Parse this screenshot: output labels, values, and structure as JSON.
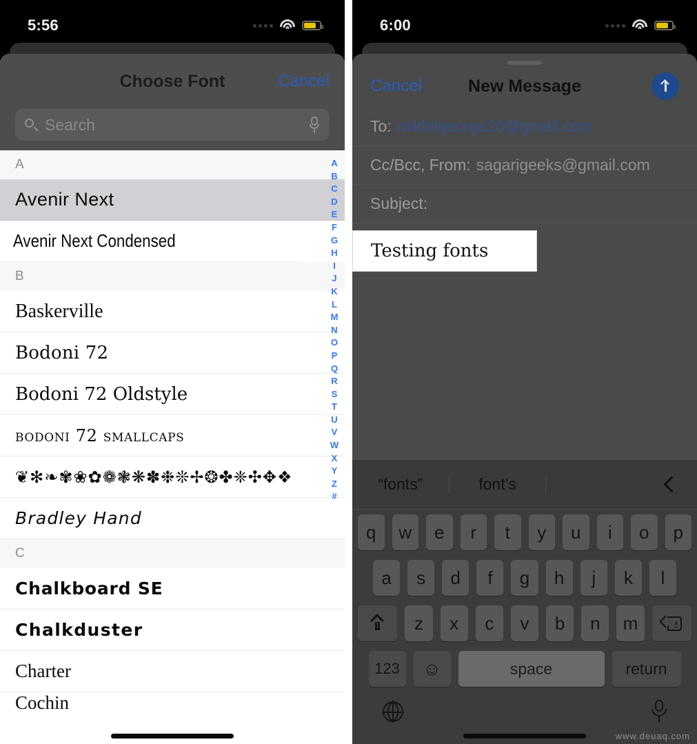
{
  "left_screen": {
    "status_bar": {
      "time": "5:56",
      "wifi_icon": "wifi-icon",
      "battery_icon": "battery-icon",
      "signal_icon": "signal-dots-icon"
    },
    "nav": {
      "title": "Choose Font",
      "cancel_label": "Cancel"
    },
    "search": {
      "placeholder": "Search",
      "value": "",
      "search_icon": "search-icon",
      "dictation_icon": "microphone-icon"
    },
    "sections": [
      {
        "letter": "A",
        "fonts": [
          {
            "name": "Avenir Next",
            "style": "f-avenir",
            "selected": true
          },
          {
            "name": "Avenir Next Condensed",
            "style": "f-avenir-cond",
            "selected": false
          }
        ]
      },
      {
        "letter": "B",
        "fonts": [
          {
            "name": "Baskerville",
            "style": "f-serif",
            "selected": false
          },
          {
            "name": "Bodoni 72",
            "style": "f-bodoni",
            "selected": false
          },
          {
            "name": "Bodoni 72 Oldstyle",
            "style": "f-oldstyle",
            "selected": false
          },
          {
            "name": "Bodoni 72 Smallcaps",
            "style": "f-smallcaps",
            "selected": false
          },
          {
            "name": "❦✻❧✾❀✿❁❃❋✽❉❊✢❂✤❈✣✥❖",
            "style": "f-ornaments",
            "selected": false
          },
          {
            "name": "Bradley Hand",
            "style": "f-bradley",
            "selected": false
          }
        ]
      },
      {
        "letter": "C",
        "fonts": [
          {
            "name": "Chalkboard SE",
            "style": "f-chalkboard",
            "selected": false
          },
          {
            "name": "Chalkduster",
            "style": "f-chalkduster",
            "selected": false
          },
          {
            "name": "Charter",
            "style": "f-charter",
            "selected": false
          },
          {
            "name": "Cochin",
            "style": "f-cochin",
            "selected": false
          }
        ]
      }
    ],
    "index_strip": [
      "A",
      "B",
      "C",
      "D",
      "E",
      "F",
      "G",
      "H",
      "I",
      "J",
      "K",
      "L",
      "M",
      "N",
      "O",
      "P",
      "Q",
      "R",
      "S",
      "T",
      "U",
      "V",
      "W",
      "X",
      "Y",
      "Z",
      "#"
    ]
  },
  "right_screen": {
    "status_bar": {
      "time": "6:00",
      "wifi_icon": "wifi-icon",
      "battery_icon": "battery-icon",
      "signal_icon": "signal-dots-icon"
    },
    "nav": {
      "cancel_label": "Cancel",
      "title": "New Message",
      "send_icon": "send-arrow-up-icon"
    },
    "fields": {
      "to_label": "To:",
      "to_value": "mikhilgeorge20@gmail.com",
      "cc_label": "Cc/Bcc, From:",
      "cc_value": "sagarigeeks@gmail.com",
      "subject_label": "Subject:",
      "subject_value": ""
    },
    "body": {
      "selected_text": "Testing fonts"
    },
    "keyboard": {
      "suggestions": [
        "“fonts”",
        "font’s"
      ],
      "collapse_icon": "chevron-left-icon",
      "row1": [
        "q",
        "w",
        "e",
        "r",
        "t",
        "y",
        "u",
        "i",
        "o",
        "p"
      ],
      "row2": [
        "a",
        "s",
        "d",
        "f",
        "g",
        "h",
        "j",
        "k",
        "l"
      ],
      "row3": [
        "z",
        "x",
        "c",
        "v",
        "b",
        "n",
        "m"
      ],
      "shift_icon": "shift-arrow-up-icon",
      "backspace_icon": "backspace-delete-icon",
      "numbers_label": "123",
      "emoji_icon": "emoji-smiley-icon",
      "space_label": "space",
      "return_label": "return",
      "globe_icon": "globe-language-icon",
      "dictation_icon": "microphone-icon"
    },
    "watermark": "www.deuaq.com"
  },
  "colors": {
    "accent_blue": "#3478f6",
    "link_blue": "#2b5bbf",
    "send_blue": "#1d4a8f",
    "selected_row": "#d0d0d5",
    "battery_yellow": "#e6c200"
  }
}
